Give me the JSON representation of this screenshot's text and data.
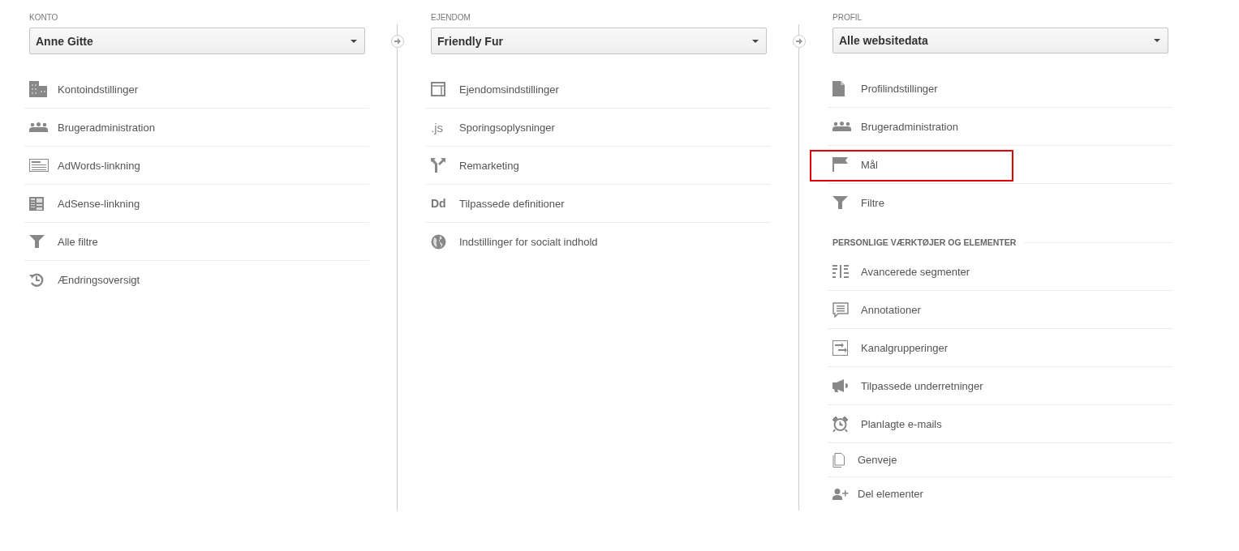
{
  "columns": [
    {
      "label": "KONTO",
      "selector": "Anne Gitte",
      "groups": [
        {
          "items": [
            {
              "text": "Kontoindstillinger",
              "highlighted": false
            },
            {
              "text": "Brugeradministration",
              "highlighted": false
            },
            {
              "text": "AdWords-linkning",
              "highlighted": false
            },
            {
              "text": "AdSense-linkning",
              "highlighted": false
            },
            {
              "text": "Alle filtre",
              "highlighted": false
            },
            {
              "text": "Ændringsoversigt",
              "highlighted": false
            }
          ]
        }
      ]
    },
    {
      "label": "EJENDOM",
      "selector": "Friendly Fur",
      "groups": [
        {
          "items": [
            {
              "text": "Ejendomsindstillinger",
              "highlighted": false
            },
            {
              "text": "Sporingsoplysninger",
              "icon_text": ".js",
              "highlighted": false
            },
            {
              "text": "Remarketing",
              "highlighted": false
            },
            {
              "text": "Tilpassede definitioner",
              "icon_text": "Dd",
              "highlighted": false
            },
            {
              "text": "Indstillinger for socialt indhold",
              "highlighted": false
            }
          ]
        }
      ]
    },
    {
      "label": "PROFIL",
      "selector": "Alle websitedata",
      "groups": [
        {
          "items": [
            {
              "text": "Profilindstillinger",
              "highlighted": false
            },
            {
              "text": "Brugeradministration",
              "highlighted": false
            },
            {
              "text": "Mål",
              "highlighted": true
            },
            {
              "text": "Filtre",
              "highlighted": false
            }
          ]
        },
        {
          "heading": "PERSONLIGE VÆRKTØJER OG ELEMENTER",
          "items": [
            {
              "text": "Avancerede segmenter",
              "highlighted": false
            },
            {
              "text": "Annotationer",
              "highlighted": false
            },
            {
              "text": "Kanalgrupperinger",
              "highlighted": false
            },
            {
              "text": "Tilpassede underretninger",
              "highlighted": false
            },
            {
              "text": "Planlagte e-mails",
              "highlighted": false
            },
            {
              "text": "Genveje",
              "highlighted": false
            },
            {
              "text": "Del elementer",
              "highlighted": false
            }
          ]
        }
      ]
    }
  ]
}
